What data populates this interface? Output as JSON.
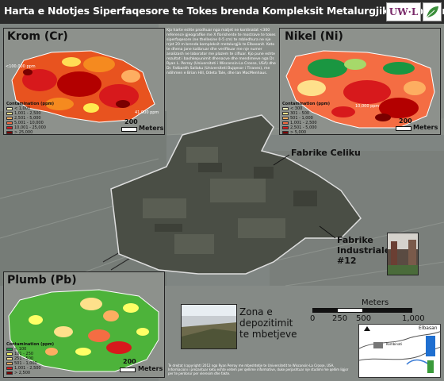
{
  "title": "Harta e Ndotjes Siperfaqesore te Tokes brenda Kompleksit Metalurgjik te Elbasanit",
  "logos": {
    "uwl_text": "UW·L",
    "leaf_icon": "leaf-logo-icon"
  },
  "info_text": "Kjo harte eshte prodhuar nga matjet ne kordinatat <300 reference gjeografike me X florishente te mostrave te tokes siperfaqesore (ne thellesine 0-5 cm) te mbledhura ne nje rrjet 20 m brenda kompleksit metalurgjik te Elbasanit. Keto te dhena jane kalibruar dhe verifikuar me nje numer analizash ne laborator me plazem te cifluar. Kjo pune eshte rezultat i bashkepunimit dhenacve dhe mendimeve nga Dr. Ryan L. Perroy (Universiteti i Wisconsin-La Crosse, USA) dhe Dr. Fatbardh Sallaku (Universiteti Bujqesor i Tiranes), me ndihmen e Brian Hill, Odeta Tale, dhe Ian MacMenhaus.",
  "panels": {
    "krom": {
      "title": "Krom (Cr)",
      "annotations": [
        "<100,000 ppm",
        "41,000 ppm"
      ],
      "scale_label": "200",
      "units": "Meters",
      "legend_title": "Contamination (ppm)",
      "legend": [
        "< 1,000",
        "1,001 - 2,500",
        "2,501 - 5,000",
        "5,001 - 10,000",
        "10,001 - 25,000",
        "> 25,000"
      ]
    },
    "nikel": {
      "title": "Nikel (Ni)",
      "annotations": [
        "10,000 ppm"
      ],
      "scale_label": "200",
      "units": "Meters",
      "legend_title": "Contamination (ppm)",
      "legend": [
        "< 300",
        "301 - 500",
        "501 - 1,000",
        "1,001 - 2,500",
        "2,501 - 5,000",
        "> 5,000"
      ]
    },
    "plumb": {
      "title": "Plumb (Pb)",
      "scale_label": "200",
      "units": "Meters",
      "legend_title": "Contamination (ppm)",
      "legend": [
        "< 100",
        "101 - 250",
        "251 - 500",
        "501 - 1,000",
        "1,001 - 2,500",
        "> 2,500"
      ]
    }
  },
  "labels": {
    "fabrike_celiku": "Fabrike Celiku",
    "fabrike_industriale": "Fabrike\nIndustriale\n#12",
    "zona": "Zona e\ndepozitimit\nte mbetjeve"
  },
  "main_scale": {
    "title": "Meters",
    "ticks": [
      "0",
      "250",
      "500",
      "1,000"
    ]
  },
  "inset": {
    "city": "Elbasan",
    "feature": "Kombinati"
  },
  "footnote": "Te drejtat (copyright) 2012 nga Ryan Perroy me mbeshtetje te Universitetit te Wisconsin-La Crosse, USA. Informacioni i prezantuar ketu eshte vetem per qellime informative, duke perjashtuar nje studimi me qellim ligjor per te perdorur per vleresim dhe fakte."
}
